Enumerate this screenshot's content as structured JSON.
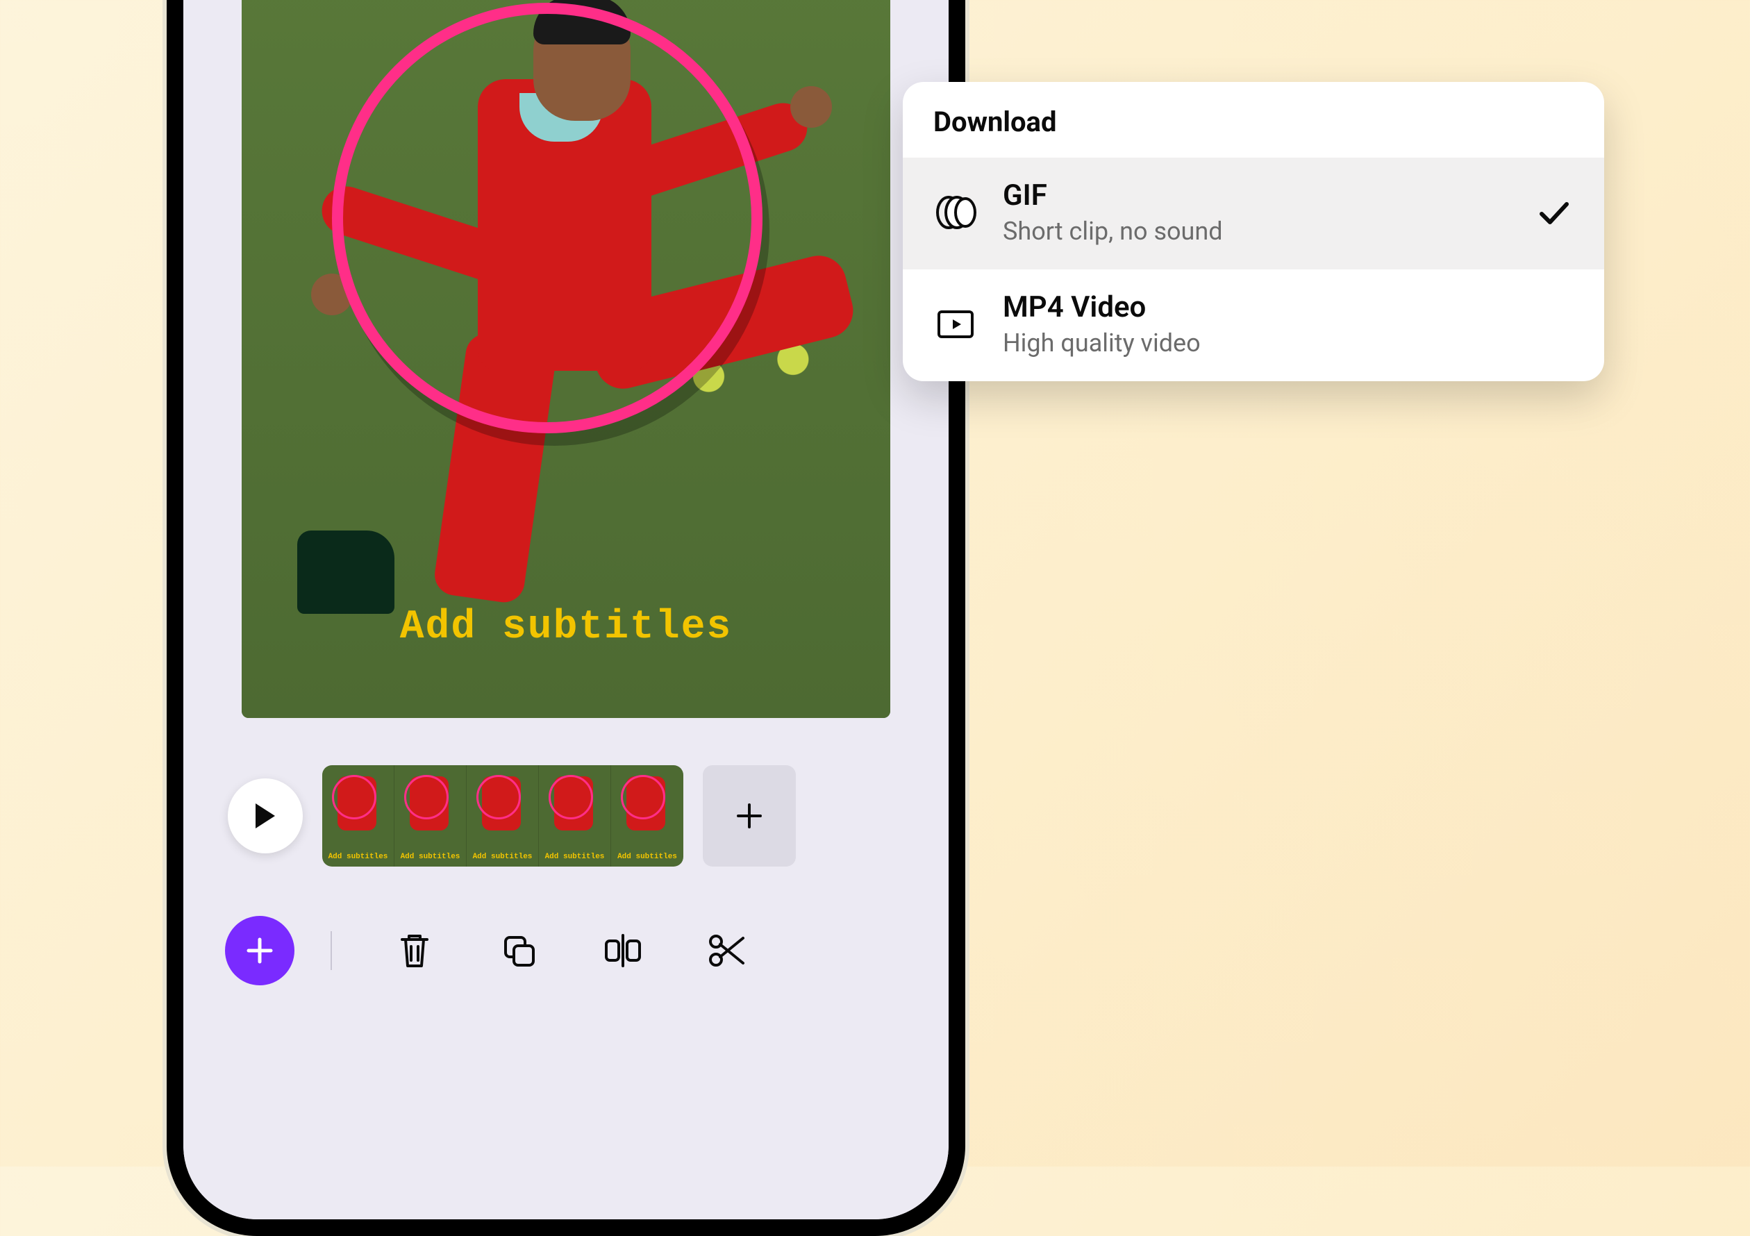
{
  "canvas": {
    "subtitle_overlay": "Add subtitles"
  },
  "timeline": {
    "frame_caption": "Add subtitles",
    "frame_count": 5
  },
  "toolbar": {
    "fab_label": "Add",
    "tools": {
      "delete": "Delete",
      "duplicate": "Duplicate",
      "split": "Split",
      "cut": "Cut"
    }
  },
  "popover": {
    "title": "Download",
    "options": [
      {
        "id": "gif",
        "title": "GIF",
        "subtitle": "Short clip, no sound",
        "selected": true,
        "icon": "gif-icon"
      },
      {
        "id": "mp4",
        "title": "MP4 Video",
        "subtitle": "High quality video",
        "selected": false,
        "icon": "video-icon"
      }
    ]
  },
  "colors": {
    "accent": "#7a2bff",
    "subtitle": "#f2c400",
    "hoop": "#ff2e88"
  }
}
